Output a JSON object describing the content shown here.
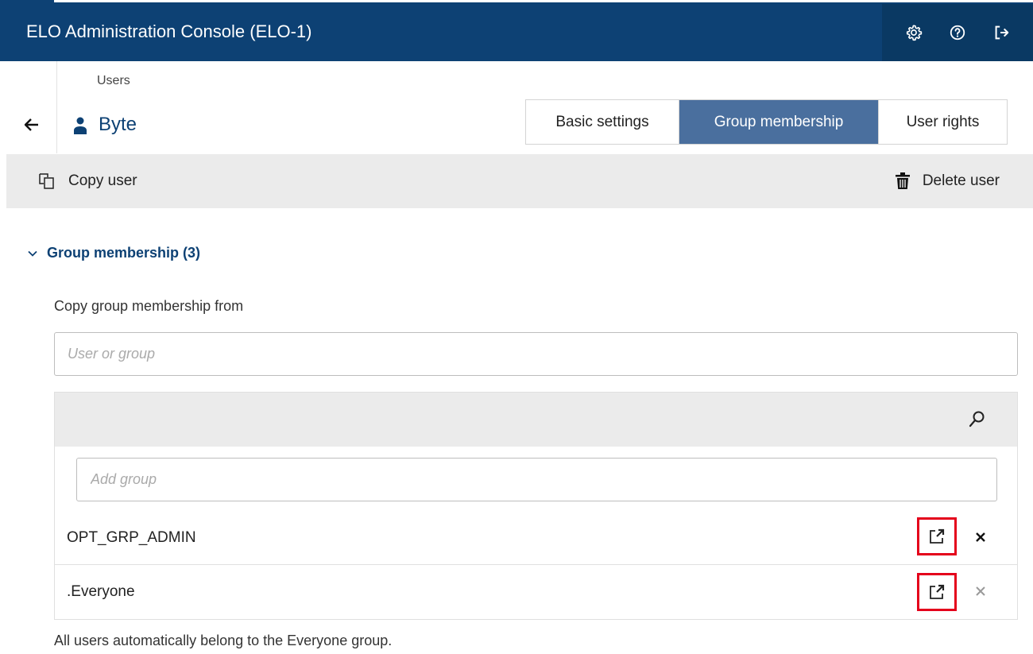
{
  "header": {
    "title": "ELO Administration Console (ELO-1)",
    "icons": [
      "gear-icon",
      "help-icon",
      "logout-icon"
    ]
  },
  "page": {
    "breadcrumb": "Users",
    "user_name": "Byte"
  },
  "tabs": [
    {
      "label": "Basic settings",
      "active": false
    },
    {
      "label": "Group membership",
      "active": true
    },
    {
      "label": "User rights",
      "active": false
    }
  ],
  "toolbar": {
    "copy_label": "Copy user",
    "delete_label": "Delete user"
  },
  "section": {
    "title": "Group membership (3)",
    "copy_from_label": "Copy group membership from",
    "copy_from_placeholder": "User or group",
    "add_group_placeholder": "Add group",
    "groups": [
      {
        "name": "OPT_GRP_ADMIN",
        "removable": true
      },
      {
        "name": ".Everyone",
        "removable": false
      }
    ],
    "footnote": "All users automatically belong to the Everyone group."
  },
  "colors": {
    "header_bg": "#0d4174",
    "active_tab_bg": "#4a6f9e",
    "highlight_border": "#e4001b"
  }
}
